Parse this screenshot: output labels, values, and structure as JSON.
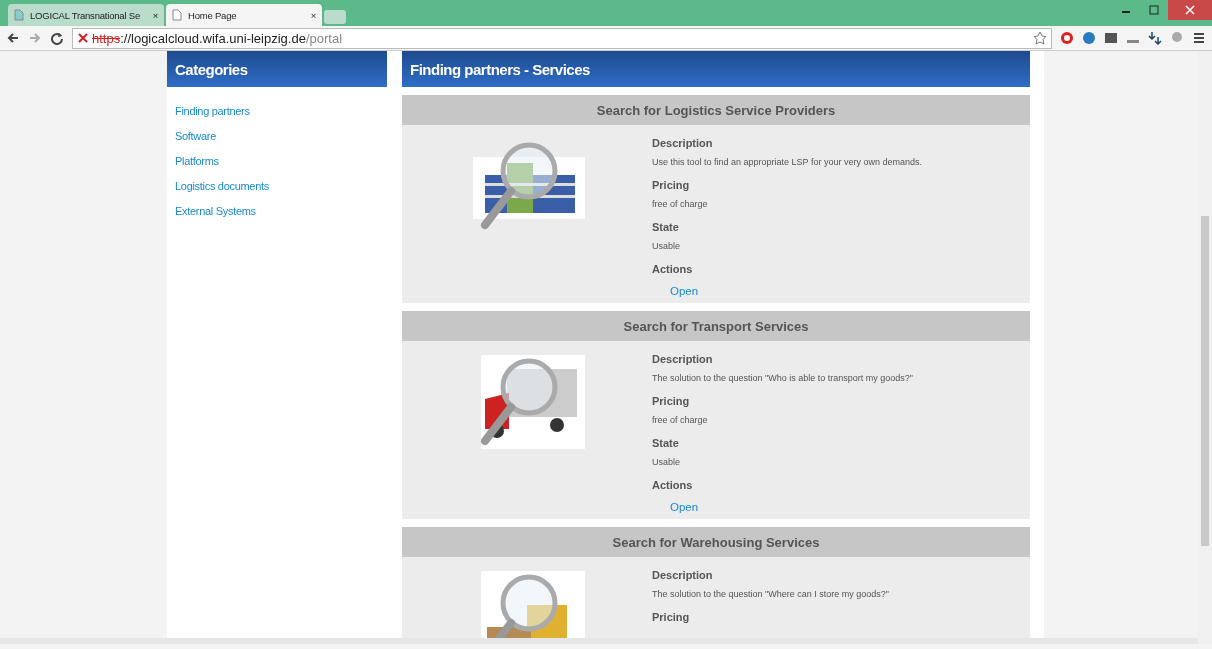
{
  "browser": {
    "tabs": [
      {
        "title": "LOGICAL Transnational Se",
        "selected": false,
        "close": "×"
      },
      {
        "title": "Home Page",
        "selected": true,
        "close": "×"
      }
    ],
    "address": {
      "scheme": "https",
      "rest": "://logicalcloud.wifa.uni-leipzig.de",
      "path": "/portal"
    }
  },
  "sidebar": {
    "title": "Categories",
    "items": [
      "Finding partners",
      "Software",
      "Platforms",
      "Logistics documents",
      "External Systems"
    ]
  },
  "main": {
    "title": "Finding partners - Services",
    "services": [
      {
        "kind": "building",
        "title": "Search for Logistics Service Providers",
        "fields": [
          {
            "label": "Description",
            "value": "Use this tool to find an appropriate LSP for your very own demands."
          },
          {
            "label": "Pricing",
            "value": "free of charge"
          },
          {
            "label": "State",
            "value": "Usable"
          }
        ],
        "actions_label": "Actions",
        "action": "Open"
      },
      {
        "kind": "truck",
        "title": "Search for Transport Services",
        "fields": [
          {
            "label": "Description",
            "value": "The solution to the question \"Who is able to transport my goods?\""
          },
          {
            "label": "Pricing",
            "value": "free of charge"
          },
          {
            "label": "State",
            "value": "Usable"
          }
        ],
        "actions_label": "Actions",
        "action": "Open"
      },
      {
        "kind": "forklift",
        "title": "Search for Warehousing Services",
        "fields": [
          {
            "label": "Description",
            "value": "The solution to the question \"Where can I store my goods?\""
          },
          {
            "label": "Pricing"
          }
        ]
      }
    ]
  }
}
